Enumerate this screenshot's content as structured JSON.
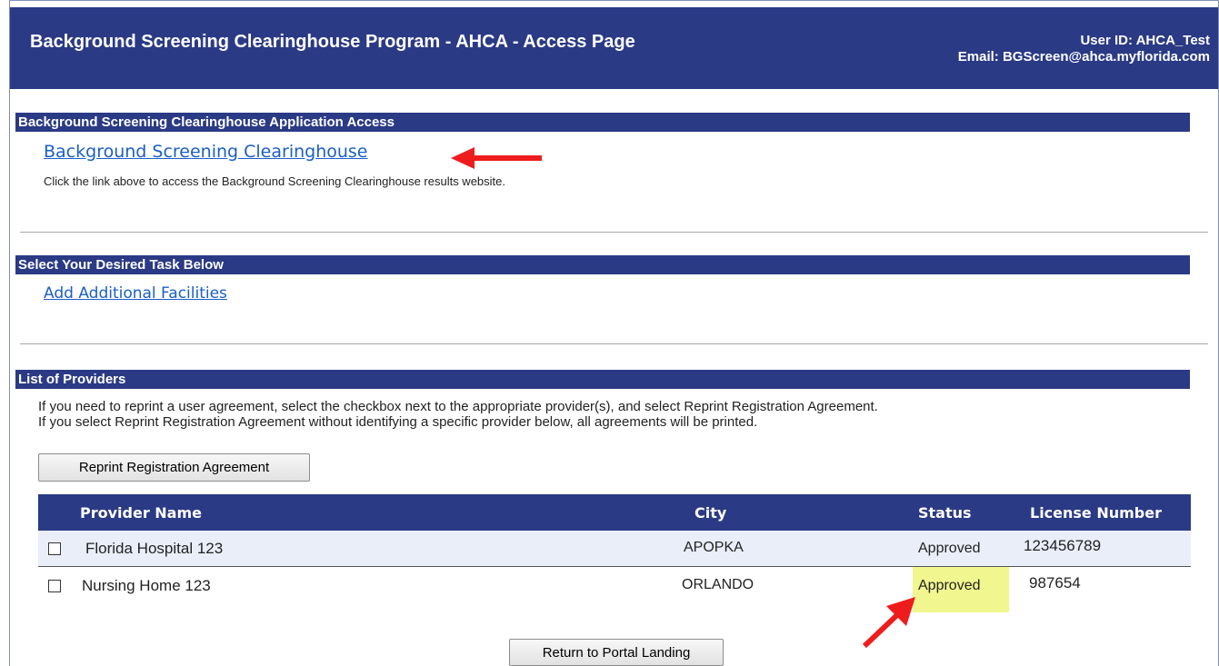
{
  "header": {
    "title": "Background Screening Clearinghouse Program - AHCA - Access Page",
    "user_id": "User ID: AHCA_Test",
    "email": "Email: BGScreen@ahca.myflorida.com"
  },
  "access_section": {
    "heading": "Background Screening Clearinghouse Application Access",
    "link_label": "Background Screening Clearinghouse",
    "helper_text": "Click the link above to access the Background Screening Clearinghouse results website."
  },
  "task_section": {
    "heading": "Select Your Desired Task Below",
    "link_label": "Add Additional Facilities"
  },
  "providers_section": {
    "heading": "List of Providers",
    "instructions_1": "If you need to reprint a user agreement, select the checkbox next to the appropriate provider(s), and select Reprint Registration Agreement.",
    "instructions_2": "If you select Reprint Registration Agreement without identifying a specific provider below, all agreements will be printed.",
    "reprint_button": "Reprint Registration Agreement",
    "columns": [
      "Provider Name",
      "City",
      "Status",
      "License Number"
    ],
    "rows": [
      {
        "provider": "Florida Hospital 123",
        "city": "APOPKA",
        "status": "Approved",
        "license": "123456789"
      },
      {
        "provider": "Nursing Home 123",
        "city": "ORLANDO",
        "status": "Approved",
        "license": "987654"
      }
    ],
    "return_button": "Return to Portal Landing"
  },
  "colors": {
    "header_bg": "#2b3a85",
    "link": "#1a5fc7",
    "highlight": "#eef57a",
    "annotation_arrow": "#ee1c1c"
  }
}
